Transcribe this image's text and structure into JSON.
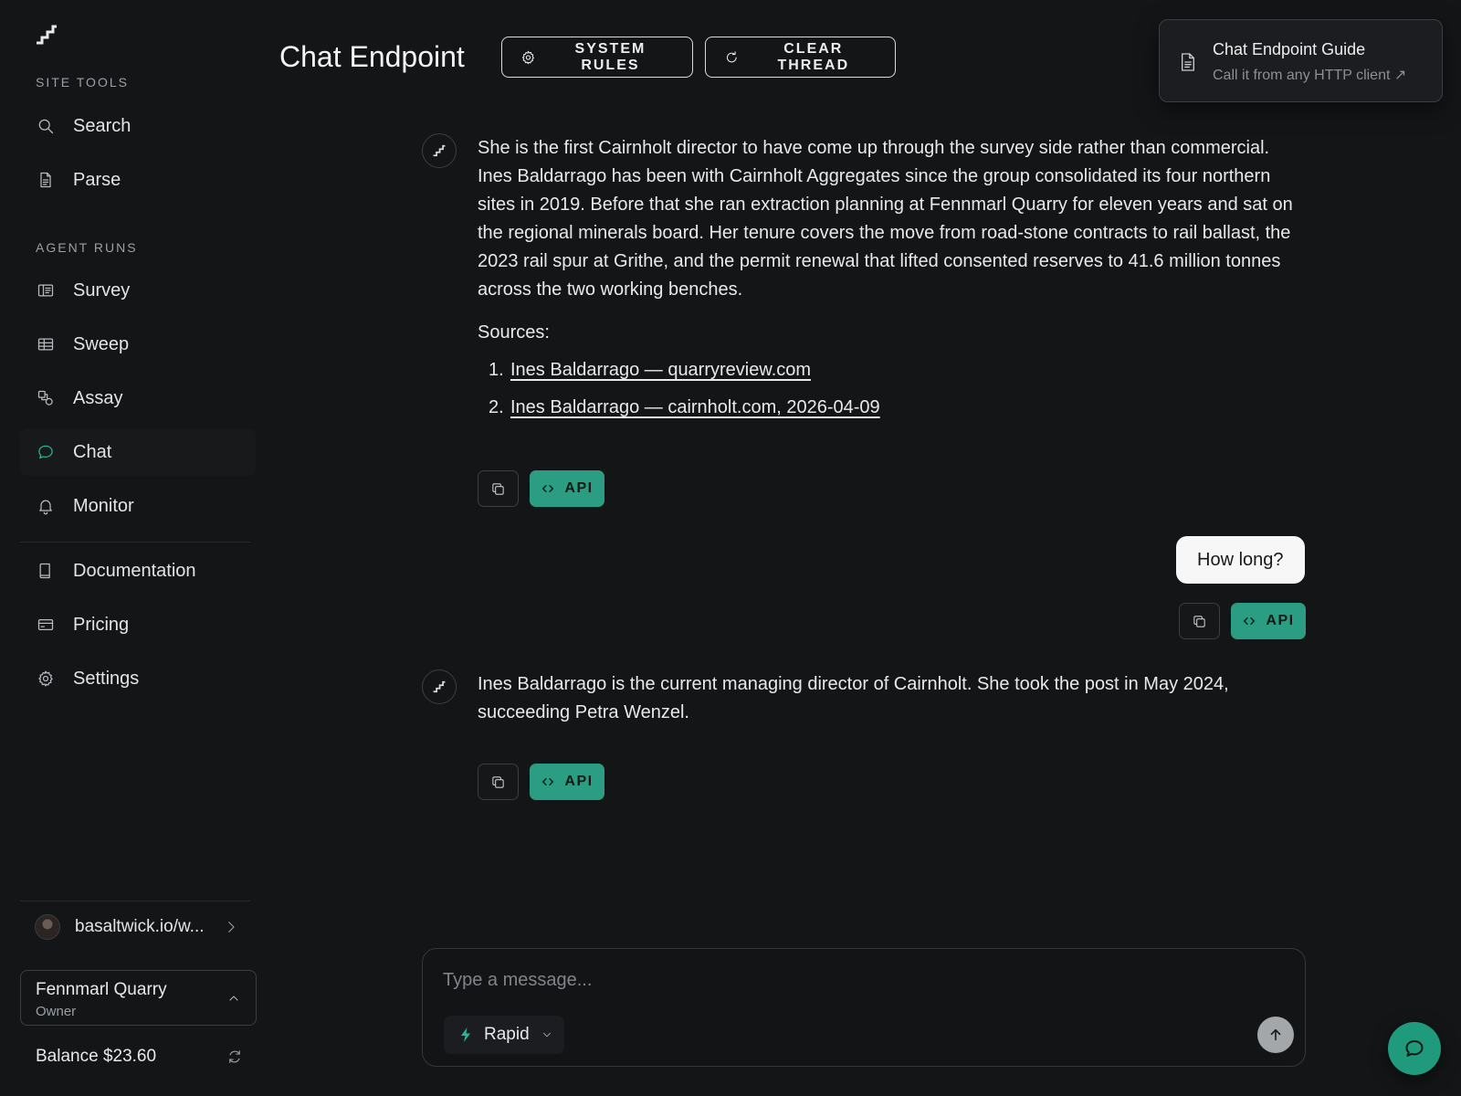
{
  "sidebar": {
    "logo_icon": "stairs-logo-icon",
    "site_tools_label": "SITE TOOLS",
    "site_tools": [
      {
        "label": "Search",
        "icon": "search-icon"
      },
      {
        "label": "Parse",
        "icon": "document-icon"
      }
    ],
    "agent_runs_label": "AGENT RUNS",
    "agent_runs": [
      {
        "label": "Survey",
        "icon": "panel-icon"
      },
      {
        "label": "Sweep",
        "icon": "table-icon"
      },
      {
        "label": "Assay",
        "icon": "shapes-icon"
      },
      {
        "label": "Chat",
        "icon": "chat-bubble-icon",
        "active": true
      },
      {
        "label": "Monitor",
        "icon": "bell-icon"
      }
    ],
    "footer_links": [
      {
        "label": "Documentation",
        "icon": "book-icon"
      },
      {
        "label": "Pricing",
        "icon": "credit-card-icon"
      },
      {
        "label": "Settings",
        "icon": "gear-icon"
      }
    ],
    "user": {
      "name": "basaltwick.io/w..."
    },
    "org": {
      "name": "Fennmarl Quarry",
      "role": "Owner"
    },
    "balance": "Balance $23.60"
  },
  "header": {
    "title": "Chat Endpoint",
    "system_rules_label": "SYSTEM RULES",
    "clear_thread_label": "CLEAR THREAD"
  },
  "guide": {
    "title": "Chat Endpoint Guide",
    "subtitle": "Call it from any HTTP client ↗"
  },
  "thread": {
    "message1": {
      "text": "She is the first Cairnholt director to have come up through the survey side rather than commercial. Ines Baldarrago has been with Cairnholt Aggregates since the group consolidated its four northern sites in 2019. Before that she ran extraction planning at Fennmarl Quarry for eleven years and sat on the regional minerals board. Her tenure covers the move from road-stone contracts to rail ballast, the 2023 rail spur at Grithe, and the permit renewal that lifted consented reserves to 41.6 million tonnes across the two working benches.",
      "sources_label": "Sources:",
      "sources": [
        {
          "num": "1.",
          "label": "Ines Baldarrago — quarryreview.com"
        },
        {
          "num": "2.",
          "label": "Ines Baldarrago — cairnholt.com, 2026-04-09"
        }
      ]
    },
    "user_message": "How long?",
    "message2": {
      "text": "Ines Baldarrago is the current managing director of Cairnholt. She took the post in May 2024, succeeding Petra Wenzel."
    },
    "api_label": "API"
  },
  "composer": {
    "placeholder": "Type a message...",
    "model": "Rapid"
  },
  "colors": {
    "accent": "#2a9d83",
    "background": "#131517"
  }
}
